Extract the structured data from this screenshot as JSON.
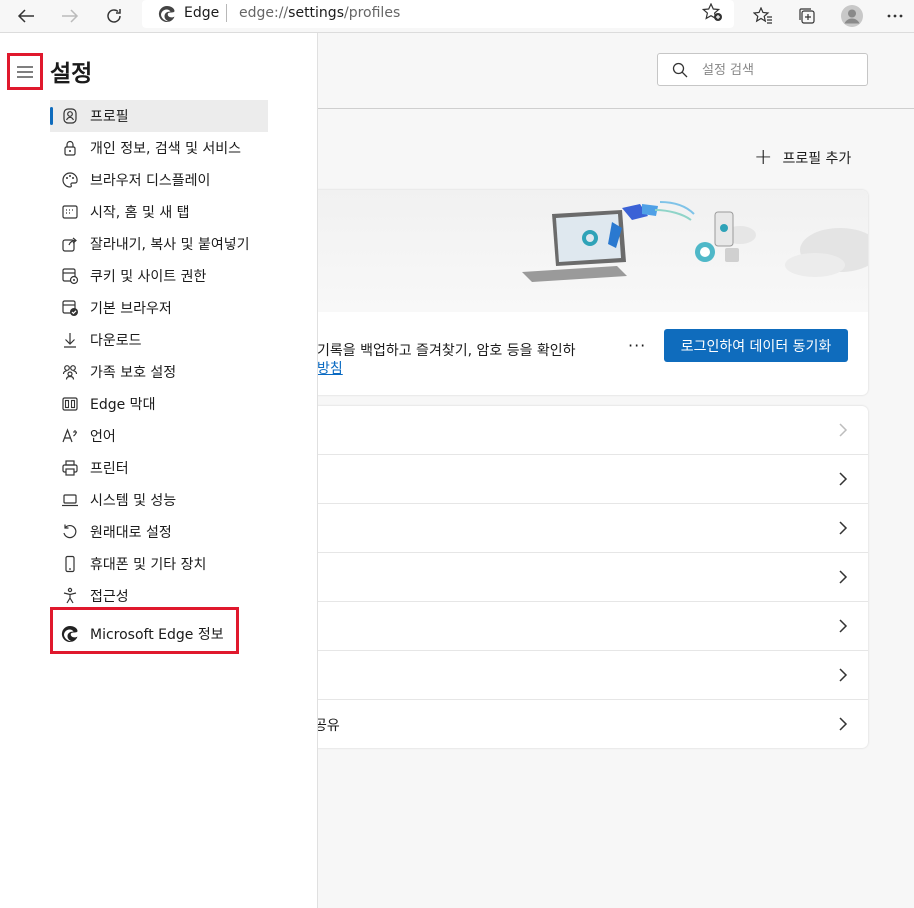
{
  "browser": {
    "site_name": "Edge",
    "url_prefix": "edge://",
    "url_host": "settings",
    "url_path": "/profiles"
  },
  "settings": {
    "title": "설정",
    "search_placeholder": "설정 검색",
    "add_profile_label": "프로필 추가",
    "sync_text_1": "기록을 백업하고 즐겨찾기, 암호 등을 확인하",
    "sync_text_2": "방침",
    "more_label": "···",
    "sync_button_label": "로그인하여 데이터 동기화",
    "last_row_label": "공유"
  },
  "nav": {
    "items": [
      {
        "label": "프로필",
        "icon": "profile-icon",
        "active": true
      },
      {
        "label": "개인 정보, 검색 및 서비스",
        "icon": "lock-icon"
      },
      {
        "label": "브라우저 디스플레이",
        "icon": "palette-icon"
      },
      {
        "label": "시작, 홈 및 새 탭",
        "icon": "new-tab-icon"
      },
      {
        "label": "잘라내기, 복사 및 붙여넣기",
        "icon": "share-icon"
      },
      {
        "label": "쿠키 및 사이트 권한",
        "icon": "site-permissions-icon"
      },
      {
        "label": "기본 브라우저",
        "icon": "default-browser-icon"
      },
      {
        "label": "다운로드",
        "icon": "download-icon"
      },
      {
        "label": "가족 보호 설정",
        "icon": "family-icon"
      },
      {
        "label": "Edge 막대",
        "icon": "edge-bar-icon"
      },
      {
        "label": "언어",
        "icon": "language-icon"
      },
      {
        "label": "프린터",
        "icon": "printer-icon"
      },
      {
        "label": "시스템 및 성능",
        "icon": "laptop-icon"
      },
      {
        "label": "원래대로 설정",
        "icon": "reset-icon"
      },
      {
        "label": "휴대폰 및 기타 장치",
        "icon": "phone-icon"
      },
      {
        "label": "접근성",
        "icon": "accessibility-icon"
      },
      {
        "label": "Microsoft Edge 정보",
        "icon": "edge-logo-icon"
      }
    ]
  },
  "colors": {
    "accent": "#0f6cbd",
    "highlight_box": "#e0182d"
  }
}
